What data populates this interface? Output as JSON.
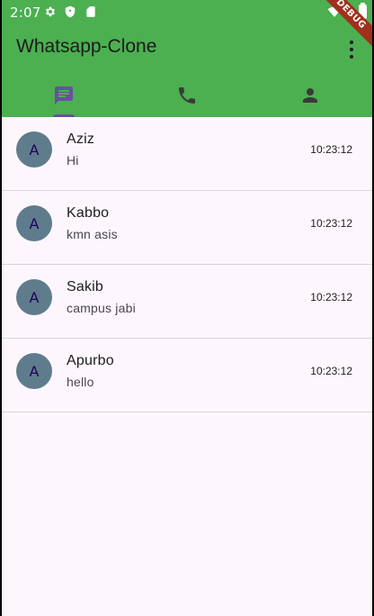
{
  "status_bar": {
    "time": "2:07",
    "icons": [
      "gear-icon",
      "shield-icon",
      "sd-card-icon",
      "wifi-icon",
      "battery-icon"
    ]
  },
  "debug_banner": "DEBUG",
  "app_bar": {
    "title": "Whatsapp-Clone",
    "menu_icon": "more-vert-icon",
    "color": "#4caf50"
  },
  "tabs": [
    {
      "icon": "chat-icon",
      "selected": true
    },
    {
      "icon": "phone-icon",
      "selected": false
    },
    {
      "icon": "person-icon",
      "selected": false
    }
  ],
  "chats": [
    {
      "avatar": "A",
      "name": "Aziz",
      "message": "Hi",
      "time": "10:23:12"
    },
    {
      "avatar": "A",
      "name": "Kabbo",
      "message": "kmn asis",
      "time": "10:23:12"
    },
    {
      "avatar": "A",
      "name": "Sakib",
      "message": "campus jabi",
      "time": "10:23:12"
    },
    {
      "avatar": "A",
      "name": "Apurbo",
      "message": "hello",
      "time": "10:23:12"
    }
  ]
}
